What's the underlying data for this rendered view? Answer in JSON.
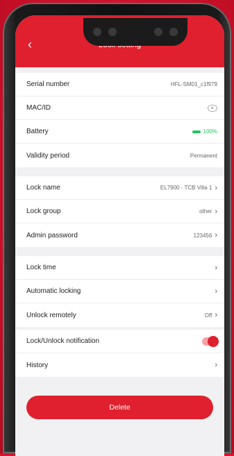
{
  "header": {
    "title": "Lock setting",
    "back_icon": "chevron-left-icon"
  },
  "device_info": [
    {
      "label": "Serial number",
      "value": "HFL-SM01_c1f979"
    },
    {
      "label": "MAC/ID",
      "icon": "eye-icon"
    },
    {
      "label": "Battery",
      "value": "100%",
      "color": "#21c45d"
    },
    {
      "label": "Validity period",
      "value": "Permanent"
    }
  ],
  "lock_info": [
    {
      "label": "Lock name",
      "value": "EL7900 - TCB Villa 1"
    },
    {
      "label": "Lock group",
      "value": "other"
    },
    {
      "label": "Admin password",
      "value": "123456"
    }
  ],
  "lock_settings": [
    {
      "label": "Lock time"
    },
    {
      "label": "Automatic locking"
    },
    {
      "label": "Unlock remotely",
      "value": "Off"
    }
  ],
  "notifications": [
    {
      "label": "Lock/Unlock notification",
      "toggle_on": true
    },
    {
      "label": "History"
    }
  ],
  "delete_label": "Delete",
  "accent_color": "#e0202e"
}
